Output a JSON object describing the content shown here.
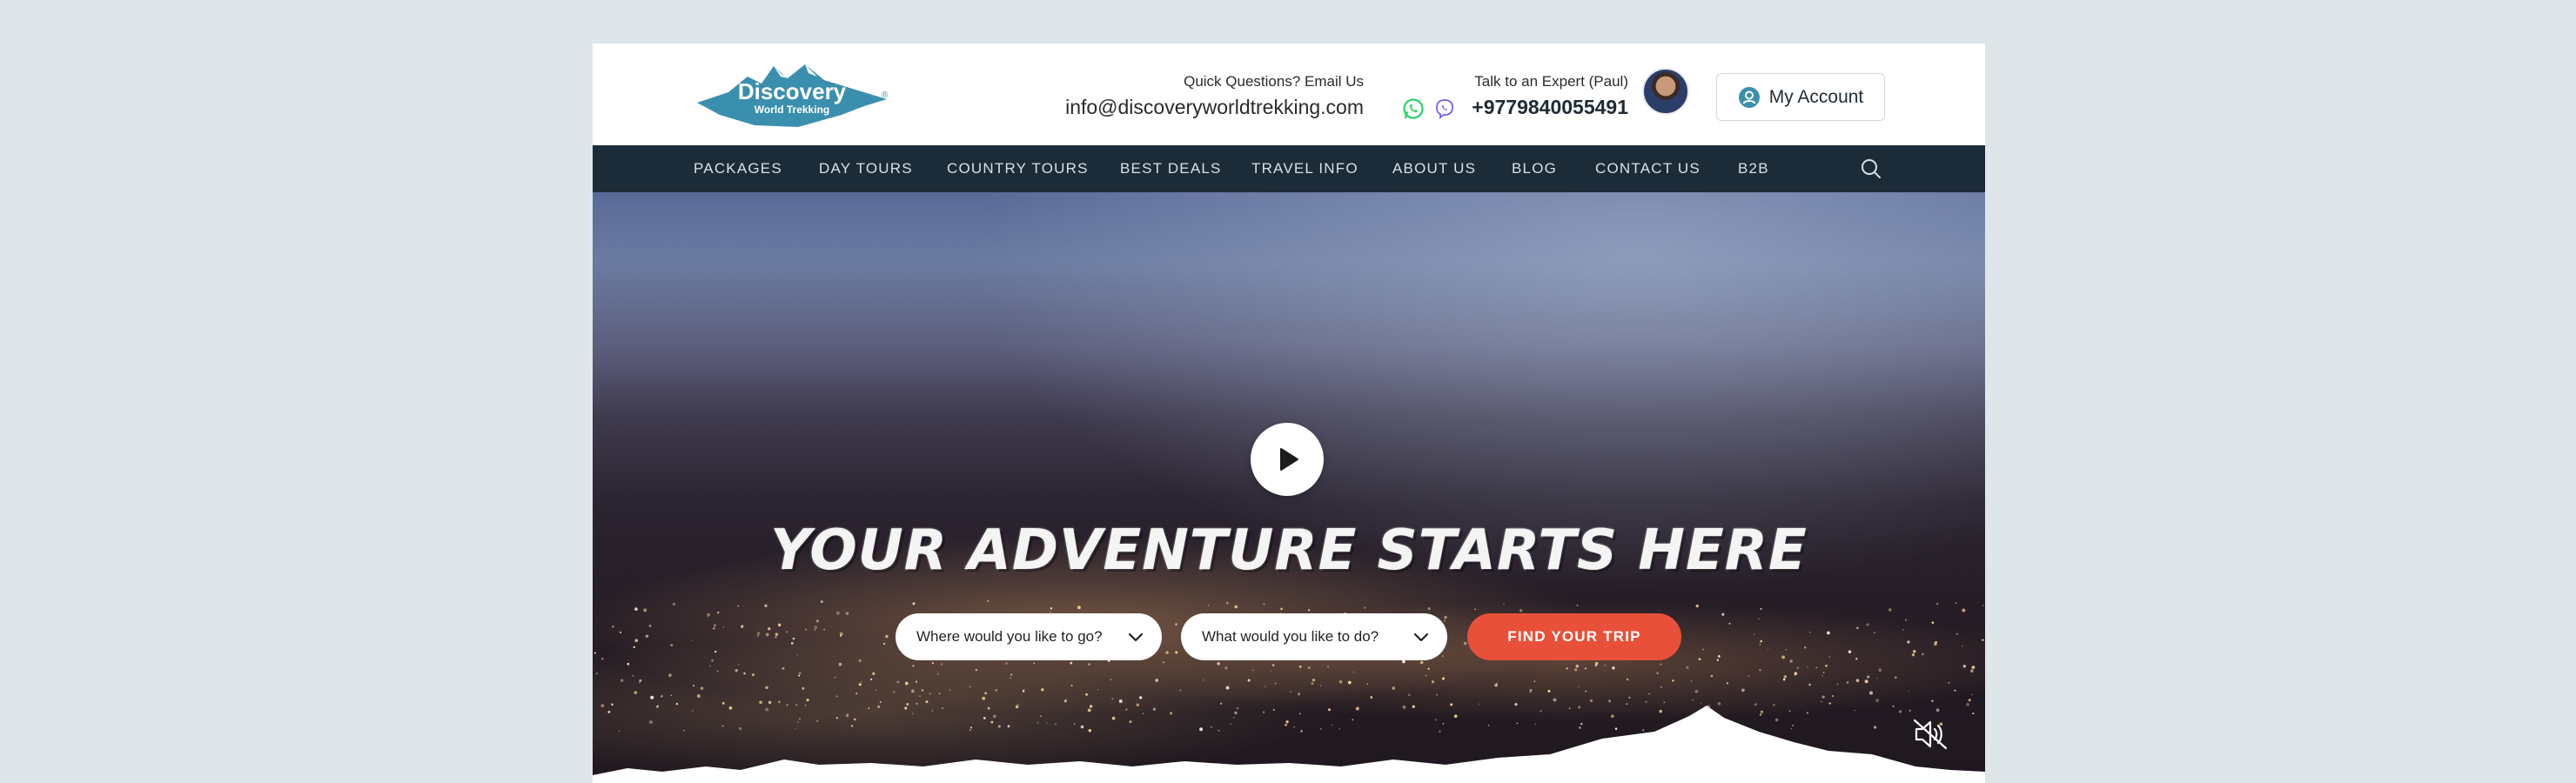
{
  "brand": {
    "logo_line1": "Discovery",
    "logo_line2": "World Trekking",
    "logo_mark": "®",
    "logo_color": "#3b8fae"
  },
  "header": {
    "email_label": "Quick Questions? Email Us",
    "email": "info@discoveryworldtrekking.com",
    "expert_label": "Talk to an Expert (Paul)",
    "phone": "+9779840055491",
    "account_label": "My Account",
    "icons": [
      "whatsapp-icon",
      "viber-icon",
      "user-circle-icon"
    ]
  },
  "nav": {
    "items": [
      {
        "label": "PACKAGES"
      },
      {
        "label": "DAY TOURS"
      },
      {
        "label": "COUNTRY TOURS"
      },
      {
        "label": "BEST DEALS"
      },
      {
        "label": "TRAVEL INFO"
      },
      {
        "label": "ABOUT US"
      },
      {
        "label": "BLOG"
      },
      {
        "label": "CONTACT US"
      },
      {
        "label": "B2B"
      }
    ],
    "search_icon": "search-icon",
    "background": "#1c2b38"
  },
  "hero": {
    "headline": "YOUR ADVENTURE STARTS HERE",
    "destination_placeholder": "Where would you like to go?",
    "activity_placeholder": "What would you like to do?",
    "cta_label": "FIND YOUR TRIP",
    "cta_color": "#e9503a",
    "play_icon": "play-icon",
    "mute_icon": "speaker-muted-icon"
  }
}
